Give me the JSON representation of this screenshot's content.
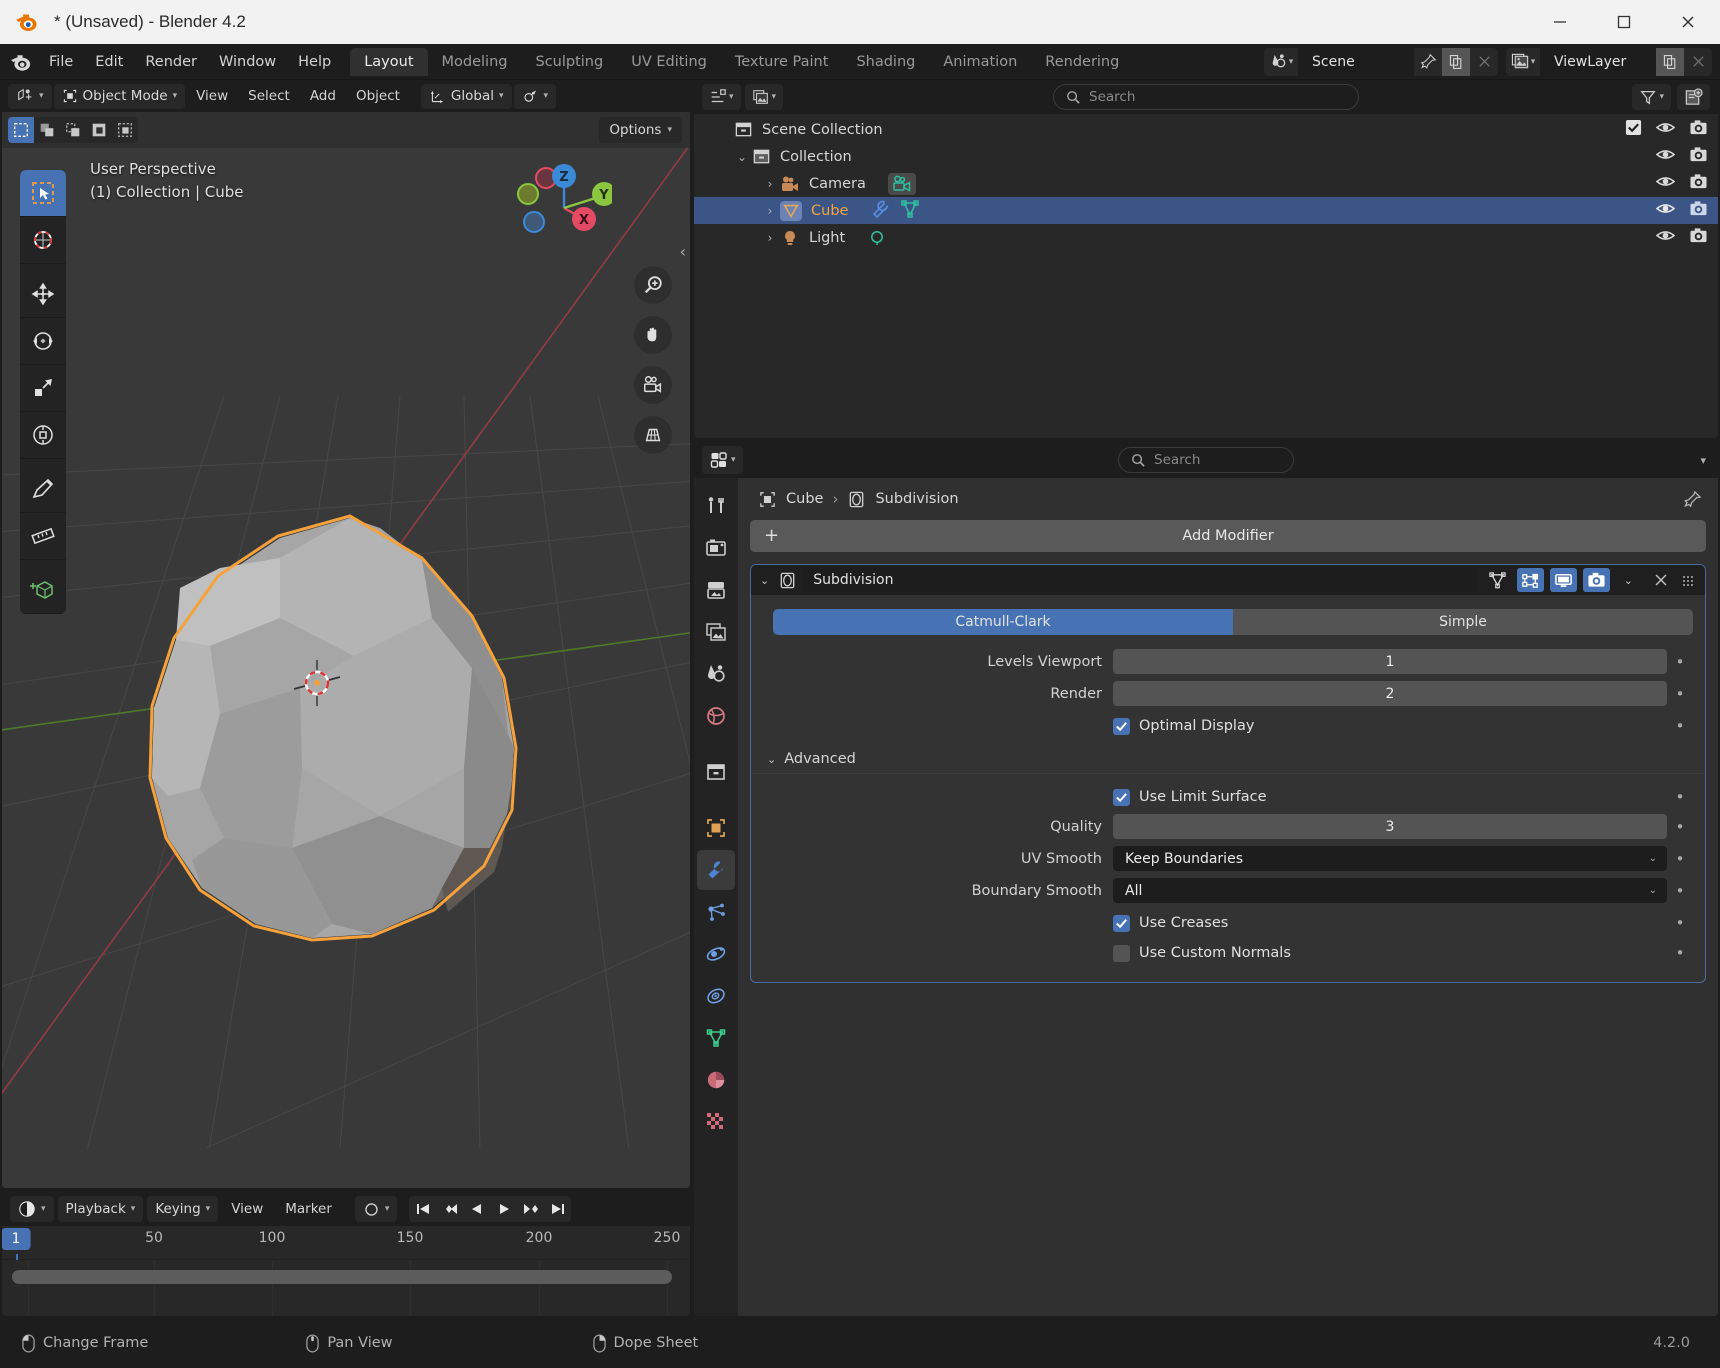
{
  "window": {
    "title": "* (Unsaved) - Blender 4.2",
    "minimize": "minimize-button",
    "maximize": "maximize-button",
    "close": "close-button"
  },
  "topbar": {
    "menus": [
      "File",
      "Edit",
      "Render",
      "Window",
      "Help"
    ],
    "workspaces": [
      {
        "label": "Layout",
        "active": true
      },
      {
        "label": "Modeling",
        "active": false
      },
      {
        "label": "Sculpting",
        "active": false
      },
      {
        "label": "UV Editing",
        "active": false
      },
      {
        "label": "Texture Paint",
        "active": false
      },
      {
        "label": "Shading",
        "active": false
      },
      {
        "label": "Animation",
        "active": false
      },
      {
        "label": "Rendering",
        "active": false
      }
    ],
    "scene": {
      "name": "Scene",
      "icon": "scene-icon"
    },
    "viewlayer": {
      "name": "ViewLayer",
      "icon": "viewlayer-icon"
    }
  },
  "viewport": {
    "header": {
      "mode": "Object Mode",
      "menus": [
        "View",
        "Select",
        "Add",
        "Object"
      ],
      "orientation": "Global"
    },
    "options_label": "Options",
    "overlay": {
      "perspective": "User Perspective",
      "context": "(1) Collection | Cube"
    },
    "tools": [
      "tweak-select-box-tool",
      "cursor-tool",
      "move-tool",
      "rotate-tool",
      "scale-tool",
      "transform-tool",
      "annotate-tool",
      "measure-tool",
      "add-cube-tool"
    ],
    "select_modes": [
      "select-box-icon",
      "select-extend-icon",
      "select-subtract-icon",
      "select-invert-icon",
      "select-intersect-icon"
    ],
    "nav_icons": [
      "zoom-icon",
      "pan-hand-icon",
      "camera-view-icon",
      "perspective-ortho-icon"
    ],
    "gizmo_axes": [
      {
        "label": "Z",
        "color": "#3b8ad8"
      },
      {
        "label": "X",
        "color": "#e44a63"
      },
      {
        "label": "Y",
        "color": "#8cc63f"
      }
    ]
  },
  "outliner": {
    "search_placeholder": "Search",
    "display_mode": "view-layer-icon",
    "filter_icon": "filter-icon",
    "new_collection_icon": "new-collection-icon",
    "rows": [
      {
        "label": "Scene Collection",
        "icon": "scene-collection-icon",
        "depth": 0,
        "disclosure": "",
        "selected": false,
        "checkbox": true,
        "eye": true,
        "camera": true
      },
      {
        "label": "Collection",
        "icon": "collection-icon",
        "depth": 1,
        "disclosure": "open",
        "selected": false,
        "checkbox": false,
        "eye": true,
        "camera": true
      },
      {
        "label": "Camera",
        "icon": "camera-object-icon",
        "depth": 2,
        "disclosure": "closed",
        "selected": false,
        "checkbox": false,
        "eye": true,
        "camera": true,
        "data_icons": [
          "camera-data-icon"
        ]
      },
      {
        "label": "Cube",
        "icon": "mesh-object-icon",
        "depth": 2,
        "disclosure": "closed",
        "selected": true,
        "checkbox": false,
        "eye": true,
        "camera": true,
        "data_icons": [
          "modifier-wrench-icon",
          "mesh-data-icon"
        ]
      },
      {
        "label": "Light",
        "icon": "light-object-icon",
        "depth": 2,
        "disclosure": "closed",
        "selected": false,
        "checkbox": false,
        "eye": true,
        "camera": true,
        "data_icons": [
          "light-data-icon"
        ]
      }
    ]
  },
  "properties": {
    "search_placeholder": "Search",
    "editor_icon": "properties-editor-icon",
    "tabs": [
      {
        "name": "tool-tab",
        "color": "#cfcfcf",
        "active": false
      },
      {
        "name": "render-tab",
        "color": "#cfcfcf",
        "active": false
      },
      {
        "name": "output-tab",
        "color": "#cfcfcf",
        "active": false
      },
      {
        "name": "view-layer-tab",
        "color": "#cfcfcf",
        "active": false
      },
      {
        "name": "scene-tab",
        "color": "#cfcfcf",
        "active": false
      },
      {
        "name": "world-tab",
        "color": "#d97b85",
        "active": false
      },
      {
        "name": "collection-tab",
        "color": "#cfcfcf",
        "active": false
      },
      {
        "name": "object-tab",
        "color": "#e0a054",
        "active": false
      },
      {
        "name": "modifiers-tab",
        "color": "#4d82d4",
        "active": true
      },
      {
        "name": "particles-tab",
        "color": "#6f9ee0",
        "active": false
      },
      {
        "name": "physics-tab",
        "color": "#6f9ee0",
        "active": false
      },
      {
        "name": "constraints-tab",
        "color": "#6f9ee0",
        "active": false
      },
      {
        "name": "object-data-tab",
        "color": "#3ecf8e",
        "active": false
      },
      {
        "name": "material-tab",
        "color": "#d06a7a",
        "active": false
      },
      {
        "name": "texture-tab",
        "color": "#d06a7a",
        "active": false
      }
    ],
    "breadcrumb": [
      {
        "label": "Cube",
        "icon": "object-icon"
      },
      {
        "label": "Subdivision",
        "icon": "modifier-icon"
      }
    ],
    "add_modifier_label": "Add Modifier",
    "modifier": {
      "name": "Subdivision",
      "expanded": true,
      "header_toggles": [
        {
          "name": "on-cage-toggle",
          "state": "neutral"
        },
        {
          "name": "edit-mode-display-toggle",
          "state": "on"
        },
        {
          "name": "realtime-viewport-toggle",
          "state": "on"
        },
        {
          "name": "render-toggle",
          "state": "on"
        }
      ],
      "extras_icon": "chevron-down-icon",
      "close_icon": "close-x-icon",
      "drag_icon": "drag-dots-icon",
      "subdivision_type": [
        {
          "label": "Catmull-Clark",
          "active": true
        },
        {
          "label": "Simple",
          "active": false
        }
      ],
      "fields": [
        {
          "label": "Levels Viewport",
          "value": "1",
          "type": "number"
        },
        {
          "label": "Render",
          "value": "2",
          "type": "number"
        }
      ],
      "optimal_display": {
        "label": "Optimal Display",
        "checked": true
      },
      "advanced": {
        "label": "Advanced",
        "expanded": true,
        "use_limit_surface": {
          "label": "Use Limit Surface",
          "checked": true
        },
        "quality": {
          "label": "Quality",
          "value": "3"
        },
        "uv_smooth": {
          "label": "UV Smooth",
          "value": "Keep Boundaries"
        },
        "boundary_smooth": {
          "label": "Boundary Smooth",
          "value": "All"
        },
        "use_creases": {
          "label": "Use Creases",
          "checked": true
        },
        "use_custom_normals": {
          "label": "Use Custom Normals",
          "checked": false
        }
      }
    }
  },
  "timeline": {
    "editor_icon": "timeline-editor-icon",
    "menus": [
      {
        "label": "Playback",
        "dropdown": true
      },
      {
        "label": "Keying",
        "dropdown": true
      },
      {
        "label": "View",
        "dropdown": false
      },
      {
        "label": "Marker",
        "dropdown": false
      }
    ],
    "keying_set_icon": "record-circle-icon",
    "playback_buttons": [
      "jump-to-start-icon",
      "prev-keyframe-icon",
      "play-reverse-icon",
      "play-icon",
      "next-keyframe-icon",
      "jump-to-end-icon"
    ],
    "current_frame": "1",
    "ticks": [
      "50",
      "100",
      "150",
      "200",
      "250"
    ]
  },
  "statusbar": {
    "items": [
      {
        "label": "Change Frame",
        "icon": "mouse-left-icon"
      },
      {
        "label": "Pan View",
        "icon": "mouse-middle-icon"
      },
      {
        "label": "Dope Sheet",
        "icon": "mouse-right-icon"
      }
    ],
    "version": "4.2.0"
  },
  "colors": {
    "accent_blue": "#4772b3",
    "selected_orange": "#f3a33c",
    "panel_bg": "#303030",
    "header_bg": "#1d1d1d",
    "viewport_bg": "#393939"
  }
}
